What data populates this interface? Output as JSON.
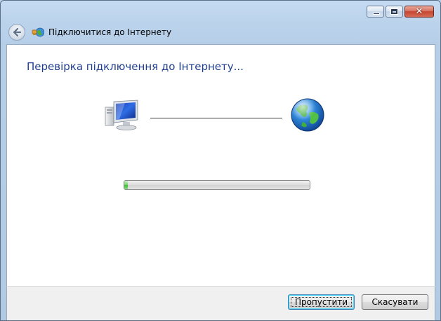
{
  "window": {
    "caption_buttons": {
      "minimize_icon": "minimize-icon",
      "maximize_icon": "maximize-icon",
      "close_icon": "close-icon",
      "close_glyph": "x"
    }
  },
  "nav": {
    "back_icon": "back-arrow-icon",
    "wizard_icon": "connect-to-internet-icon",
    "title": "Підключитися до Інтернету"
  },
  "main": {
    "heading": "Перевірка підключення до Інтернету...",
    "computer_icon": "computer-icon",
    "globe_icon": "globe-icon",
    "progress": 0.02
  },
  "footer": {
    "skip_label": "Пропустити",
    "cancel_label": "Скасувати"
  },
  "colors": {
    "heading": "#1e3d8f",
    "progress_fill": "#3fbf36",
    "close_button": "#c5452f"
  }
}
